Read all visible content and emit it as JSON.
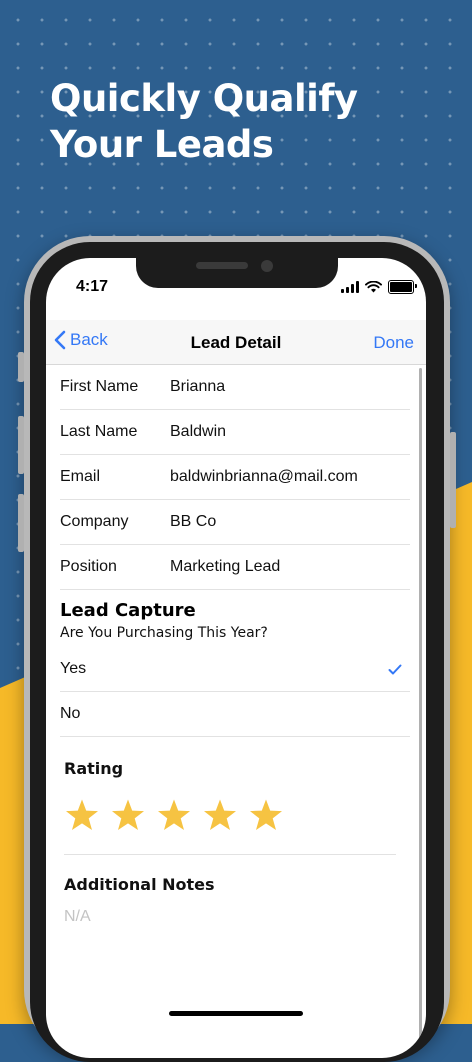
{
  "headline": [
    "Quickly Qualify",
    "Your Leads"
  ],
  "colors": {
    "background_blue": "#2d5f8f",
    "background_yellow": "#f6b928",
    "ios_blue": "#3478f6",
    "star_yellow": "#f6c342"
  },
  "status_bar": {
    "time": "4:17",
    "icons": [
      "signal-icon",
      "wifi-icon",
      "battery-icon"
    ]
  },
  "navbar": {
    "back_label": "Back",
    "title": "Lead Detail",
    "done_label": "Done"
  },
  "fields": [
    {
      "label": "First Name",
      "value": "Brianna"
    },
    {
      "label": "Last Name",
      "value": "Baldwin"
    },
    {
      "label": "Email",
      "value": "baldwinbrianna@mail.com"
    },
    {
      "label": "Company",
      "value": "BB Co"
    },
    {
      "label": "Position",
      "value": "Marketing Lead"
    }
  ],
  "lead_capture": {
    "title": "Lead Capture",
    "question": "Are You Purchasing This Year?",
    "options": [
      {
        "label": "Yes",
        "selected": true
      },
      {
        "label": "No",
        "selected": false
      }
    ]
  },
  "rating": {
    "label": "Rating",
    "value": 5,
    "max": 5
  },
  "notes": {
    "label": "Additional Notes",
    "placeholder": "N/A"
  }
}
